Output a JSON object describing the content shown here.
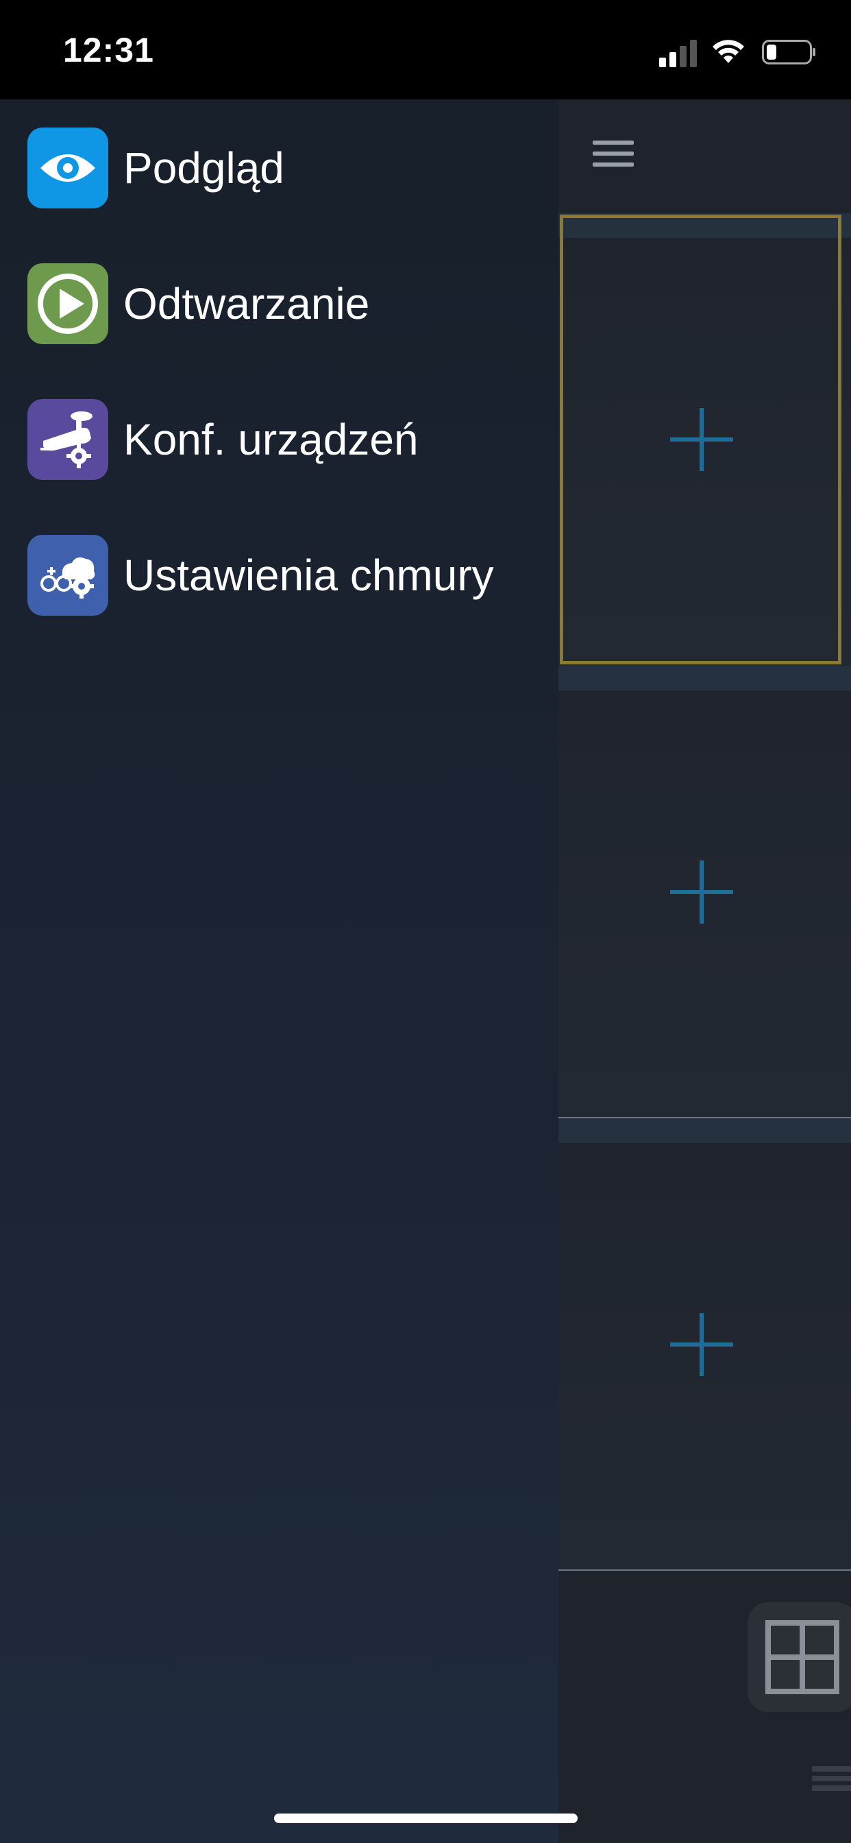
{
  "status_bar": {
    "time": "12:31"
  },
  "drawer": {
    "items": [
      {
        "label": "Podgląd",
        "icon": "eye-icon",
        "color": "#0f97e6"
      },
      {
        "label": "Odtwarzanie",
        "icon": "play-icon",
        "color": "#6d9a4d"
      },
      {
        "label": "Konf. urządzeń",
        "icon": "camera-settings-icon",
        "color": "#5a4a9e"
      },
      {
        "label": "Ustawienia chmury",
        "icon": "cloud-settings-icon",
        "color": "#3f61ad"
      }
    ]
  },
  "colors": {
    "accent_plus": "#1d6f99",
    "selected_border": "#8d7a2c"
  }
}
